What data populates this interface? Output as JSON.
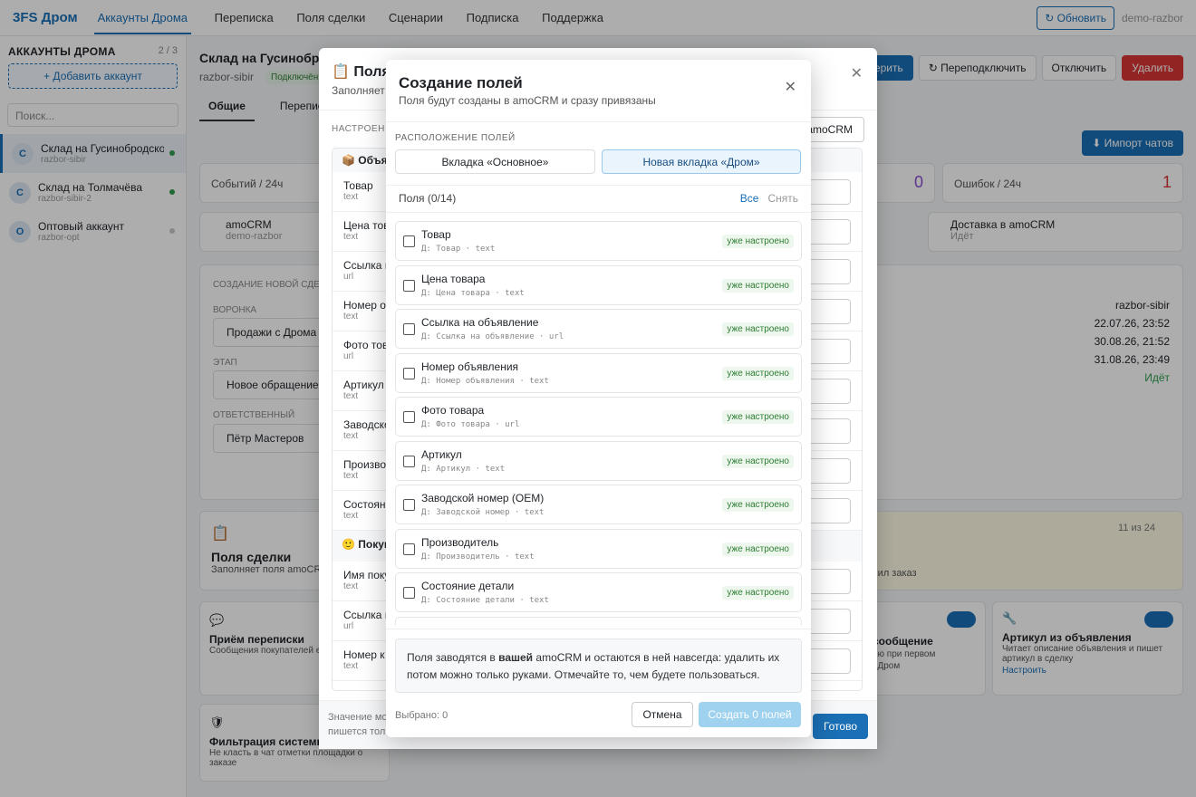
{
  "nav": {
    "brand": "3FS Дром",
    "items": [
      "Аккаунты Дрома",
      "Переписка",
      "Поля сделки",
      "Сценарии",
      "Подписка",
      "Поддержка"
    ],
    "refresh": "Обновить",
    "user": "demo-razbor"
  },
  "sidebar": {
    "title": "АККАУНТЫ ДРОМА",
    "count": "2 / 3",
    "add": "+ Добавить аккаунт",
    "search_placeholder": "Поиск...",
    "accounts": [
      {
        "initial": "С",
        "name": "Склад на Гусинобродском",
        "login": "razbor-sibir",
        "status_color": "#2e9d4e"
      },
      {
        "initial": "С",
        "name": "Склад на Толмачёва",
        "login": "razbor-sibir-2",
        "status_color": "#2e9d4e"
      },
      {
        "initial": "О",
        "name": "Оптовый аккаунт",
        "login": "razbor-opt",
        "status_color": "#c4c8cc"
      }
    ]
  },
  "bg": {
    "title": "Склад на Гусинобро",
    "login": "razbor-sibir",
    "badge": "Подключён",
    "tab1": "Общие",
    "tab2": "Переписка",
    "btn_check": "верить",
    "btn_reconnect": "Переподключить",
    "btn_disconnect": "Отключить",
    "btn_delete": "Удалить",
    "btn_import": "Импорт чатов",
    "events_label": "Событий / 24ч",
    "errors_label": "Ошибок / 24ч",
    "errors_val": "1",
    "zero_val": "0",
    "amocrm": "amoCRM",
    "amocrm_sub": "demo-razbor",
    "delivery": "Доставка в amoCRM",
    "delivery_sub": "Идёт",
    "info": [
      "razbor-sibir",
      "22.07.26, 23:52",
      "30.08.26, 21:52",
      "31.08.26, 23:49",
      "Идёт"
    ],
    "new_deal": "СОЗДАНИЕ НОВОЙ СДЕ",
    "funnel_label": "ВОРОНКА",
    "funnel": "Продажи с Дрома",
    "stage_label": "ЭТАП",
    "stage": "Новое обращение",
    "resp_label": "ОТВЕТСТВЕННЫЙ",
    "resp": "Пётр Мастеров",
    "deal_fields": "Поля сделки",
    "deal_fields_sub": "Заполняет поля amoCRM",
    "count_11": "11 из 24",
    "ordered": "рмил заказ",
    "recv": "Приём переписки",
    "recv_sub": "Сообщения покупателей ед",
    "msg": "е сообщение",
    "msg_sub": "телю при первом",
    "msg_sub2": "т в Дром",
    "art": "Артикул из объявления",
    "art_sub": "Читает описание объявления и пишет артикул в сделку",
    "art_link": "Настроить",
    "filter": "Фильтрация системны",
    "filter_sub": "Не класть в чат отметки площадки о заказе"
  },
  "mid": {
    "title": "Поля",
    "sub": "Заполняет",
    "section": "НАСТРОЕН",
    "amocrm_btn": "amoCRM",
    "group1": "Объяв",
    "group2": "Покуп",
    "rows": [
      {
        "n": "Товар",
        "t": "text"
      },
      {
        "n": "Цена това",
        "t": "text"
      },
      {
        "n": "Ссылка н",
        "t": "url"
      },
      {
        "n": "Номер о",
        "t": "text"
      },
      {
        "n": "Фото това",
        "t": "url"
      },
      {
        "n": "Артикул",
        "t": "text"
      },
      {
        "n": "Заводско",
        "t": "text"
      },
      {
        "n": "Производ",
        "t": "text"
      },
      {
        "n": "Состояние",
        "t": "text"
      }
    ],
    "rows2": [
      {
        "n": "Имя поку",
        "t": "text"
      },
      {
        "n": "Ссылка н",
        "t": "url"
      },
      {
        "n": "Номер к",
        "t": "text"
      }
    ],
    "footer": "Значение мо",
    "footer2": "пишется тол",
    "done": "Готово"
  },
  "modal": {
    "title": "Создание полей",
    "sub": "Поля будут созданы в amoCRM и сразу привязаны",
    "section": "РАСПОЛОЖЕНИЕ ПОЛЕЙ",
    "seg1": "Вкладка «Основное»",
    "seg2": "Новая вкладка «Дром»",
    "fields_count": "Поля (0/14)",
    "all": "Все",
    "clear": "Снять",
    "items": [
      {
        "name": "Товар",
        "sub": "Д: Товар · text",
        "tag": "уже настроено"
      },
      {
        "name": "Цена товара",
        "sub": "Д: Цена товара · text",
        "tag": "уже настроено"
      },
      {
        "name": "Ссылка на объявление",
        "sub": "Д: Ссылка на объявление · url",
        "tag": "уже настроено"
      },
      {
        "name": "Номер объявления",
        "sub": "Д: Номер объявления · text",
        "tag": "уже настроено"
      },
      {
        "name": "Фото товара",
        "sub": "Д: Фото товара · url",
        "tag": "уже настроено"
      },
      {
        "name": "Артикул",
        "sub": "Д: Артикул · text",
        "tag": "уже настроено"
      },
      {
        "name": "Заводской номер (OEM)",
        "sub": "Д: Заводской номер · text",
        "tag": "уже настроено"
      },
      {
        "name": "Производитель",
        "sub": "Д: Производитель · text",
        "tag": "уже настроено"
      },
      {
        "name": "Состояние детали",
        "sub": "Д: Состояние детали · text",
        "tag": "уже настроено"
      }
    ],
    "note_pre": "Поля заводятся в ",
    "note_bold": "вашей",
    "note_post": " amoCRM и остаются в ней навсегда: удалить их потом можно только руками. Отмечайте то, чем будете пользоваться.",
    "selected": "Выбрано: 0",
    "cancel": "Отмена",
    "create": "Создать 0 полей"
  }
}
